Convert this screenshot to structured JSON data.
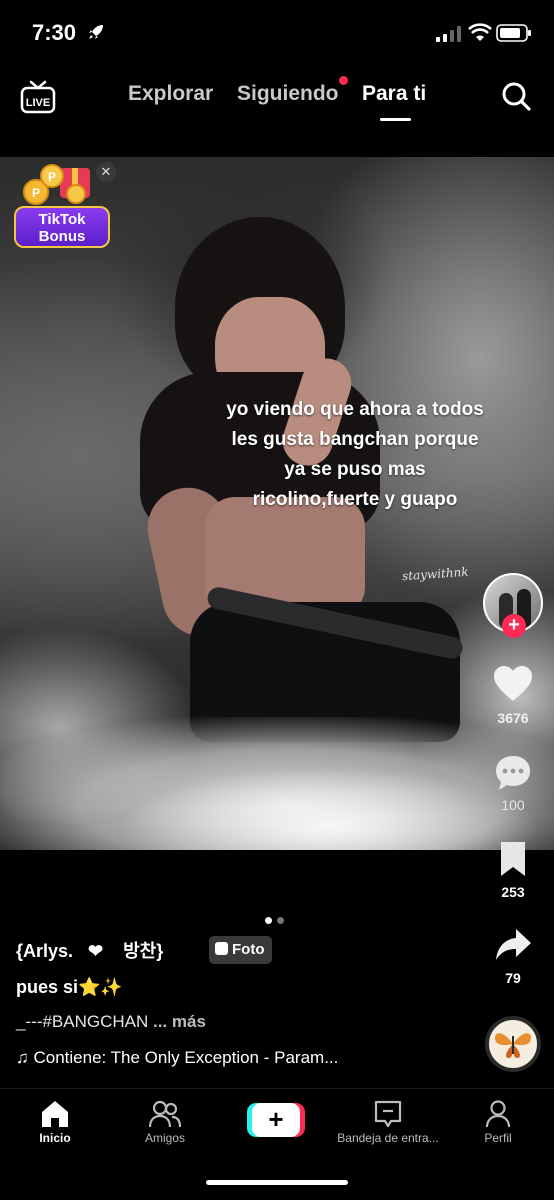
{
  "status_bar": {
    "time": "7:30"
  },
  "top_nav": {
    "live_label": "LIVE",
    "tabs": [
      {
        "label": "Explorar"
      },
      {
        "label": "Siguiendo"
      },
      {
        "label": "Para ti"
      }
    ],
    "active_tab": "Para ti"
  },
  "bonus": {
    "line1": "TikTok",
    "line2": "Bonus",
    "close": "✕"
  },
  "post": {
    "caption_lines": [
      "yo viendo que ahora a todos",
      "les gusta bangchan porque",
      "ya se puso mas",
      "ricolino,fuerte y guapo"
    ],
    "watermark": "staywithnk",
    "pager": {
      "current": 1,
      "total": 2
    },
    "author": "{Arlys.   ❤    방찬}",
    "type_badge": "Foto",
    "description": "pues si⭐✨",
    "tags": "_---#BANGCHAN",
    "more": "... más",
    "music": "♫ Contiene: The Only Exception - Param..."
  },
  "actions": {
    "likes": "3676",
    "comments": "100",
    "saves": "253",
    "shares": "79"
  },
  "bottom_nav": {
    "items": [
      {
        "label": "Inicio"
      },
      {
        "label": "Amigos"
      },
      {
        "label": "+"
      },
      {
        "label": "Bandeja de entra..."
      },
      {
        "label": "Perfil"
      }
    ]
  },
  "colors": {
    "accent_red": "#fe2c55",
    "accent_cyan": "#25f4ee",
    "bonus_purple": "#6a28d9"
  }
}
